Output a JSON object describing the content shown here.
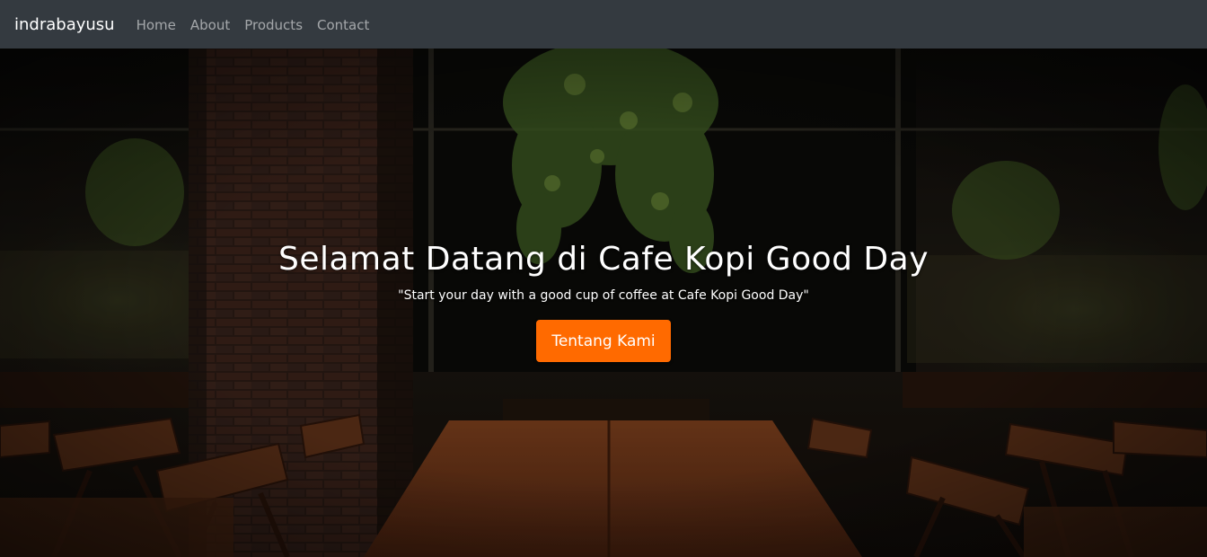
{
  "navbar": {
    "brand": "indrabayusu",
    "links": [
      "Home",
      "About",
      "Products",
      "Contact"
    ]
  },
  "hero": {
    "title": "Selamat Datang di Cafe Kopi Good Day",
    "quote": "\"Start your day with a good cup of coffee at Cafe Kopi Good Day\"",
    "button_label": "Tentang Kami"
  },
  "colors": {
    "navbar_bg": "#343a40",
    "accent": "#ff6a00",
    "text": "#ffffff"
  }
}
